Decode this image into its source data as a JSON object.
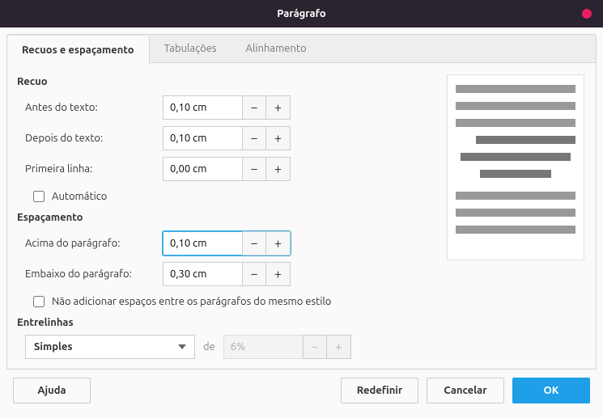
{
  "title": "Parágrafo",
  "tabs": {
    "t0": "Recuos e espaçamento",
    "t1": "Tabulações",
    "t2": "Alinhamento"
  },
  "section": {
    "recuo": "Recuo",
    "espacamento": "Espaçamento",
    "entrelinhas": "Entrelinhas"
  },
  "labels": {
    "antes": "Antes do texto:",
    "depois": "Depois do texto:",
    "primeira": "Primeira linha:",
    "auto": "Automático",
    "acima": "Acima do parágrafo:",
    "embaixo": "Embaixo do parágrafo:",
    "nosame": "Não adicionar espaços entre os parágrafos do mesmo estilo",
    "de": "de"
  },
  "values": {
    "antes": "0,10 cm",
    "depois": "0,10 cm",
    "primeira": "0,00 cm",
    "acima": "0,10 cm",
    "embaixo": "0,30 cm",
    "lines_select": "Simples",
    "lines_pct": "6%"
  },
  "buttons": {
    "help": "Ajuda",
    "reset": "Redefinir",
    "cancel": "Cancelar",
    "ok": "OK"
  },
  "glyph": {
    "minus": "−",
    "plus": "+"
  }
}
